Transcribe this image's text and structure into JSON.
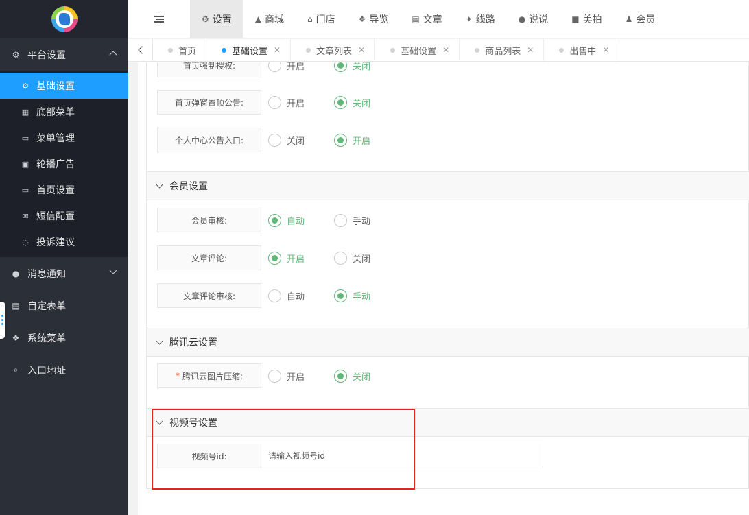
{
  "sidebar": {
    "groups": {
      "platform": {
        "label": "平台设置"
      },
      "messages": {
        "label": "消息通知"
      },
      "forms": {
        "label": "自定表单"
      },
      "system": {
        "label": "系统菜单"
      },
      "entry": {
        "label": "入口地址"
      }
    },
    "items": [
      {
        "label": "基础设置",
        "icon": "gear-icon"
      },
      {
        "label": "底部菜单",
        "icon": "grid-icon"
      },
      {
        "label": "菜单管理",
        "icon": "monitor-icon"
      },
      {
        "label": "轮播广告",
        "icon": "image-icon"
      },
      {
        "label": "首页设置",
        "icon": "monitor-icon"
      },
      {
        "label": "短信配置",
        "icon": "envelope-icon"
      },
      {
        "label": "投诉建议",
        "icon": "chat-icon"
      }
    ]
  },
  "topnav": {
    "items": [
      {
        "label": "设置",
        "icon": "gears-icon"
      },
      {
        "label": "商城",
        "icon": "bag-icon"
      },
      {
        "label": "门店",
        "icon": "bank-icon"
      },
      {
        "label": "导览",
        "icon": "cubes-icon"
      },
      {
        "label": "文章",
        "icon": "newspaper-icon"
      },
      {
        "label": "线路",
        "icon": "leaf-icon"
      },
      {
        "label": "说说",
        "icon": "wechat-icon"
      },
      {
        "label": "美拍",
        "icon": "video-icon"
      },
      {
        "label": "会员",
        "icon": "user-icon"
      }
    ]
  },
  "tabs": [
    {
      "label": "首页"
    },
    {
      "label": "基础设置"
    },
    {
      "label": "文章列表"
    },
    {
      "label": "基础设置"
    },
    {
      "label": "商品列表"
    },
    {
      "label": "出售中"
    }
  ],
  "form": {
    "top": {
      "force_auth": {
        "label": "首页强制授权:",
        "opt1": "开启",
        "opt2": "关闭"
      },
      "popup_notice": {
        "label": "首页弹窗置顶公告:",
        "opt1": "开启",
        "opt2": "关闭"
      },
      "user_notice": {
        "label": "个人中心公告入口:",
        "opt1": "关闭",
        "opt2": "开启"
      }
    },
    "member": {
      "title": "会员设置",
      "review": {
        "label": "会员审核:",
        "opt1": "自动",
        "opt2": "手动"
      },
      "comment": {
        "label": "文章评论:",
        "opt1": "开启",
        "opt2": "关闭"
      },
      "comment_review": {
        "label": "文章评论审核:",
        "opt1": "自动",
        "opt2": "手动"
      }
    },
    "tencent": {
      "title": "腾讯云设置",
      "compress": {
        "label": "腾讯云图片压缩:",
        "required_mark": "*",
        "opt1": "开启",
        "opt2": "关闭"
      }
    },
    "channels": {
      "title": "视频号设置",
      "id": {
        "label": "视频号id:",
        "placeholder": "请输入视频号id",
        "value": ""
      }
    }
  },
  "colors": {
    "accent": "#1e9fff",
    "radio_checked": "#5fb878",
    "highlight": "#e5231f",
    "sidebar": "#2a2f38"
  }
}
